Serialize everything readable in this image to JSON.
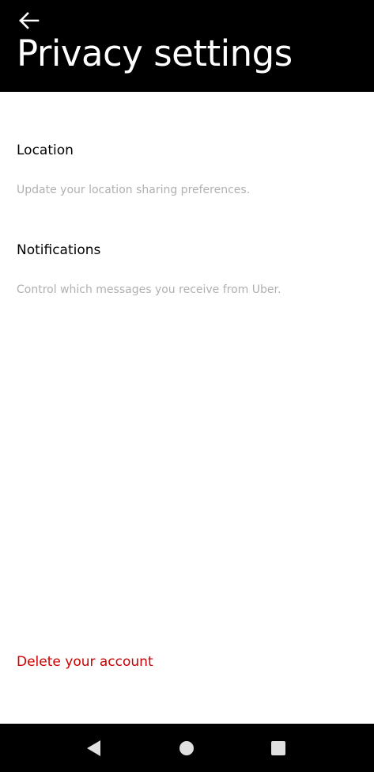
{
  "header": {
    "title": "Privacy settings",
    "back_icon": "arrow-left-icon"
  },
  "items": [
    {
      "title": "Location",
      "description": "Update your location sharing preferences."
    },
    {
      "title": "Notifications",
      "description": "Control which messages you receive from Uber."
    }
  ],
  "footer": {
    "delete_label": "Delete your account"
  },
  "navbar": {
    "back_icon": "triangle-back-icon",
    "home_icon": "circle-home-icon",
    "recents_icon": "square-recents-icon"
  },
  "colors": {
    "header_bg": "#000000",
    "title_text": "#ffffff",
    "item_title": "#000000",
    "item_desc": "#b0b0b0",
    "danger": "#cc0000"
  }
}
